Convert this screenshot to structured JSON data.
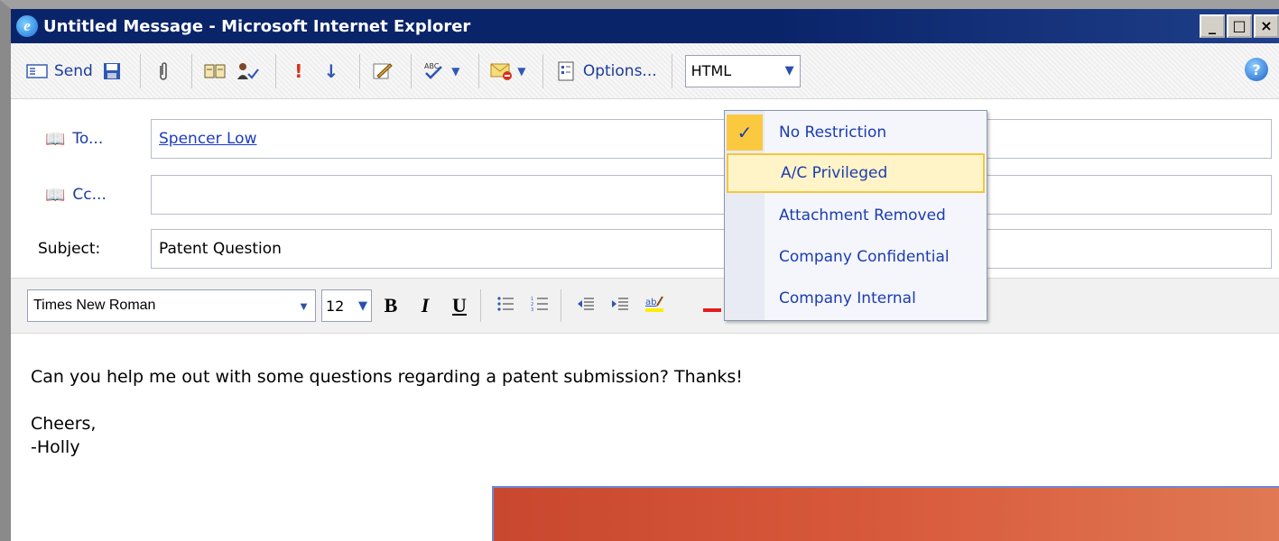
{
  "window": {
    "title": "Untitled Message - Microsoft Internet Explorer",
    "controls": [
      "_",
      "□",
      "×"
    ]
  },
  "toolbar": {
    "send_label": "Send",
    "options_label": "Options...",
    "format_value": "HTML",
    "icons": [
      "send-icon",
      "save-icon",
      "attach-icon",
      "address-book-icon",
      "check-names-icon",
      "high-importance-icon",
      "low-importance-icon",
      "signature-icon",
      "spell-check-icon",
      "restriction-icon",
      "options-icon",
      "help-icon"
    ]
  },
  "fields": {
    "to_label": "To...",
    "to_value": "Spencer Low",
    "cc_label": "Cc...",
    "cc_value": "",
    "subject_label": "Subject:",
    "subject_value": "Patent Question"
  },
  "format": {
    "font_name": "Times New Roman",
    "font_size": "12",
    "bold": "B",
    "italic": "I",
    "underline": "U"
  },
  "body": {
    "line1": "Can you help me out with some questions regarding a patent submission? Thanks!",
    "line2": "Cheers,",
    "line3": "-Holly"
  },
  "restriction_menu": {
    "selected": "No Restriction",
    "items": [
      {
        "label": "No Restriction",
        "checked": true
      },
      {
        "label": "A/C Privileged",
        "highlighted": true
      },
      {
        "label": "Attachment Removed"
      },
      {
        "label": "Company Confidential"
      },
      {
        "label": "Company Internal"
      }
    ]
  },
  "colors": {
    "title_bar": "#0a246a",
    "link": "#1c3cc0",
    "menu_highlight": "#fff4c8",
    "check_bg": "#fbc940"
  }
}
